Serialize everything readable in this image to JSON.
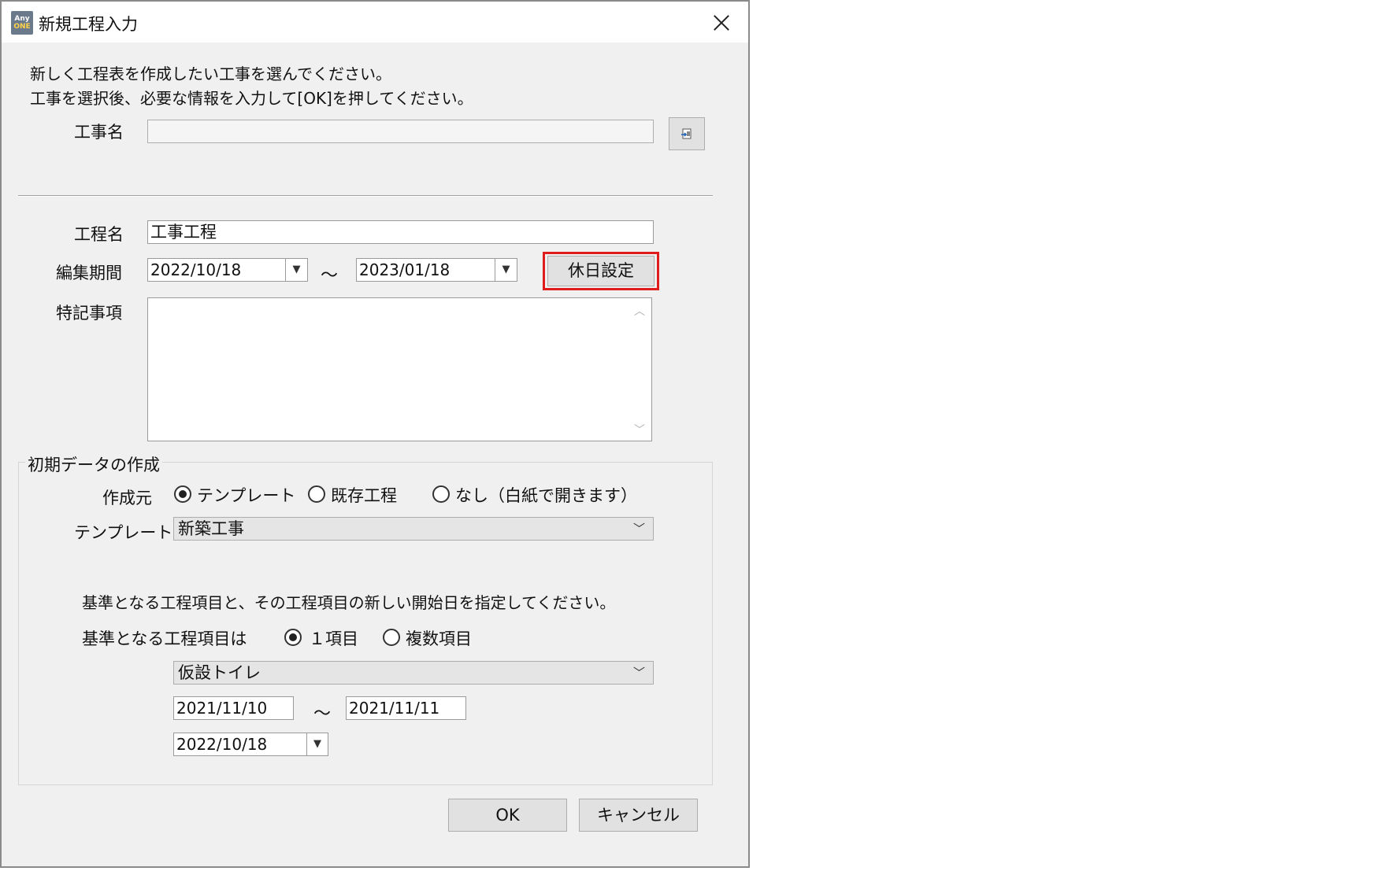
{
  "window": {
    "title": "新規工程入力",
    "app_icon_top": "Any",
    "app_icon_bottom": "ONE"
  },
  "instructions": {
    "line1": "新しく工程表を作成したい工事を選んでください。",
    "line2": "工事を選択後、必要な情報を入力して[OK]を押してください。"
  },
  "construction": {
    "label": "工事名",
    "value": "",
    "picker_icon": "select-icon"
  },
  "schedule": {
    "name_label": "工程名",
    "name_value": "工事工程",
    "period_label": "編集期間",
    "period_start": "2022/10/18",
    "period_end": "2023/01/18",
    "tilde": "～",
    "holiday_button": "休日設定",
    "notes_label": "特記事項",
    "notes_value": ""
  },
  "initial_data": {
    "group_title": "初期データの作成",
    "source_label": "作成元",
    "source_options": [
      "テンプレート",
      "既存工程",
      "なし（白紙で開きます）"
    ],
    "source_selected": "テンプレート",
    "template_label": "テンプレート",
    "template_value": "新築工事",
    "base_instruction": "基準となる工程項目と、その工程項目の新しい開始日を指定してください。",
    "base_label": "基準となる工程項目は",
    "base_options": [
      "１項目",
      "複数項目"
    ],
    "base_selected": "１項目",
    "base_item_value": "仮設トイレ",
    "item_start": "2021/11/10",
    "item_end": "2021/11/11",
    "new_start": "2022/10/18",
    "tilde": "～"
  },
  "buttons": {
    "ok": "OK",
    "cancel": "キャンセル"
  },
  "colors": {
    "highlight": "#e01b1b",
    "dialog_bg": "#f0f0f0"
  }
}
